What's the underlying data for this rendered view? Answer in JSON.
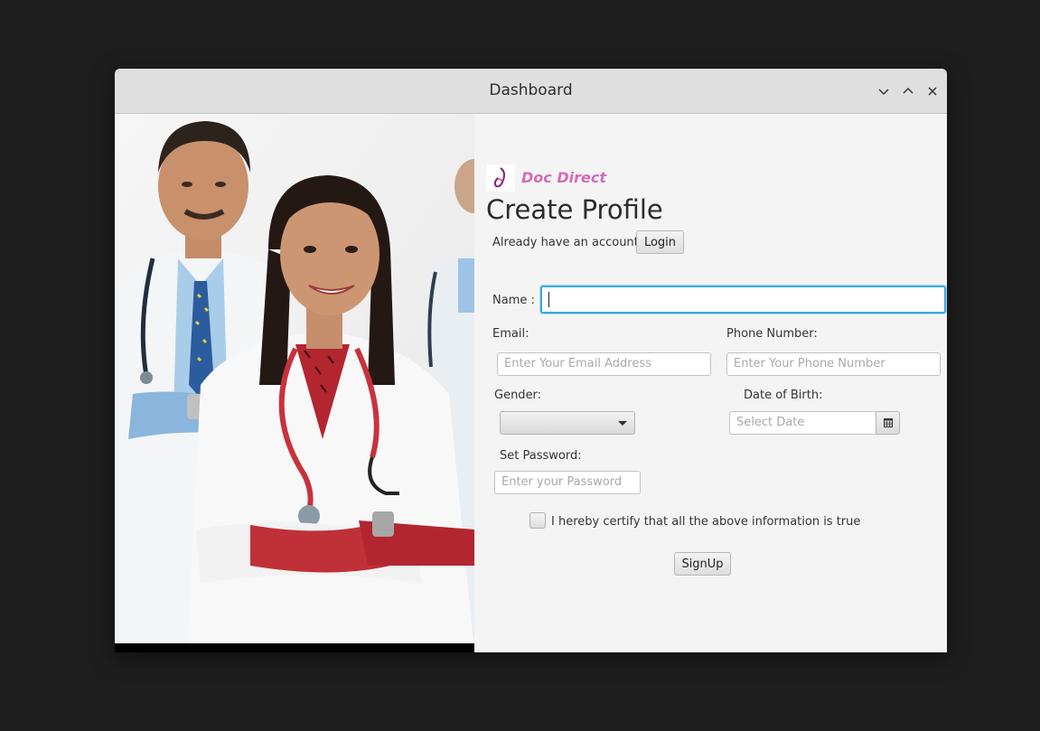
{
  "window": {
    "title": "Dashboard",
    "controls": [
      "minimize",
      "maximize",
      "close"
    ]
  },
  "brand": {
    "name": "Doc Direct",
    "color": "#d66ab8"
  },
  "form": {
    "heading": "Create Profile",
    "have_account_text": "Already have an account?",
    "login_label": "Login",
    "name_label": "Name :",
    "name_value": "",
    "email_label": "Email:",
    "email_placeholder": "Enter Your Email Address",
    "phone_label": "Phone Number:",
    "phone_placeholder": "Enter Your Phone Number",
    "gender_label": "Gender:",
    "gender_value": "",
    "dob_label": "Date of Birth:",
    "dob_placeholder": "Select Date",
    "password_label": "Set Password:",
    "password_placeholder": "Enter your Password",
    "certify_text": "I hereby certify that all the above information is true",
    "certify_checked": false,
    "signup_label": "SignUp"
  },
  "colors": {
    "focus_ring": "#3da8e0",
    "background": "#f4f4f4"
  }
}
